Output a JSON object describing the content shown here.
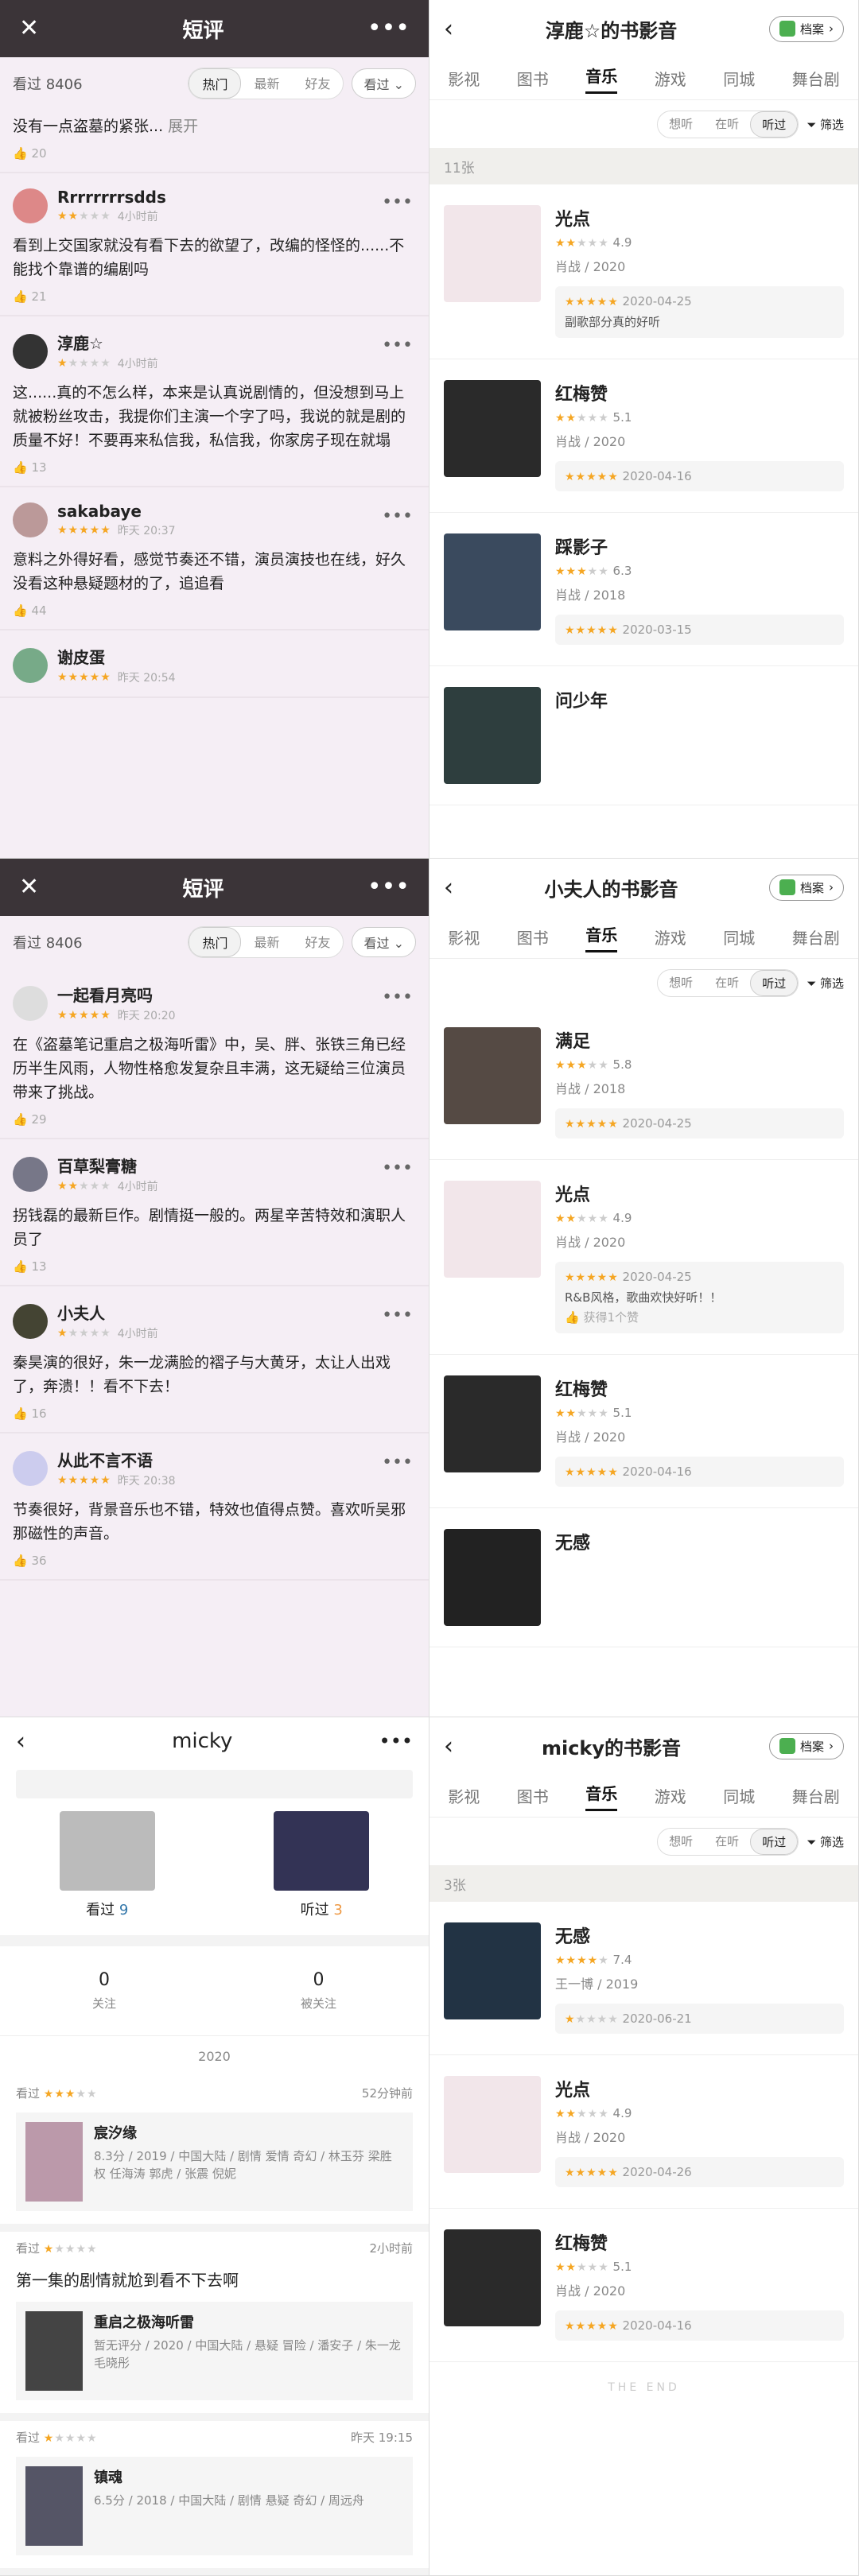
{
  "review_header": {
    "title": "短评",
    "count_label": "看过",
    "count": "8406",
    "tabs": [
      "热门",
      "最新",
      "好友"
    ],
    "filter": "看过"
  },
  "review1": [
    {
      "truncated_text": "没有一点盗墓的紧张...",
      "expand": "展开",
      "likes": "20"
    },
    {
      "user": "Rrrrrrrrsdds",
      "time": "4小时前",
      "stars": 2,
      "text": "看到上交国家就没有看下去的欲望了，改编的怪怪的......不能找个靠谱的编剧吗",
      "likes": "21"
    },
    {
      "user": "淳鹿☆",
      "time": "4小时前",
      "stars": 1,
      "text": "这......真的不怎么样，本来是认真说剧情的，但没想到马上就被粉丝攻击，我提你们主演一个字了吗，我说的就是剧的质量不好！不要再来私信我，私信我，你家房子现在就塌",
      "likes": "13"
    },
    {
      "user": "sakabaye",
      "time": "昨天 20:37",
      "stars": 5,
      "text": "意料之外得好看，感觉节奏还不错，演员演技也在线，好久没看这种悬疑题材的了，追追看",
      "likes": "44"
    },
    {
      "user": "谢皮蛋",
      "time": "昨天 20:54",
      "stars": 5
    }
  ],
  "review2": [
    {
      "user": "一起看月亮吗",
      "time": "昨天 20:20",
      "stars": 5,
      "text": "在《盗墓笔记重启之极海听雷》中，吴、胖、张铁三角已经历半生风雨，人物性格愈发复杂且丰满，这无疑给三位演员带来了挑战。",
      "likes": "29"
    },
    {
      "user": "百草梨膏糖",
      "time": "4小时前",
      "stars": 2,
      "text": "拐钱磊的最新巨作。剧情挺一般的。两星辛苦特效和演职人员了",
      "likes": "13"
    },
    {
      "user": "小夫人",
      "time": "4小时前",
      "stars": 1,
      "text": "秦昊演的很好，朱一龙满脸的褶子与大黄牙，太让人出戏了，奔溃！！看不下去！",
      "likes": "16"
    },
    {
      "user": "从此不言不语",
      "time": "昨天 20:38",
      "stars": 5,
      "text": "节奏很好，背景音乐也不错，特效也值得点赞。喜欢听吴邪那磁性的声音。",
      "likes": "36"
    }
  ],
  "archive_label": "档案",
  "cat_tabs": [
    "影视",
    "图书",
    "音乐",
    "游戏",
    "同城",
    "舞台剧"
  ],
  "sub_tabs": [
    "想听",
    "在听",
    "听过"
  ],
  "filter_label": "筛选",
  "bs1": {
    "title": "淳鹿☆的书影音",
    "count": "11张",
    "items": [
      {
        "name": "光点",
        "score": "4.9",
        "stars": 2.5,
        "artist": "肖战 / 2020",
        "date": "2020-04-25",
        "user_stars": 5,
        "note": "副歌部分真的好听"
      },
      {
        "name": "红梅赞",
        "score": "5.1",
        "stars": 2.5,
        "artist": "肖战 / 2020",
        "date": "2020-04-16",
        "user_stars": 5
      },
      {
        "name": "踩影子",
        "score": "6.3",
        "stars": 3,
        "artist": "肖战 / 2018",
        "date": "2020-03-15",
        "user_stars": 5
      },
      {
        "name": "问少年"
      }
    ]
  },
  "bs2": {
    "title": "小夫人的书影音",
    "items": [
      {
        "name": "满足",
        "score": "5.8",
        "stars": 3,
        "artist": "肖战 / 2018",
        "date": "2020-04-25",
        "user_stars": 5
      },
      {
        "name": "光点",
        "score": "4.9",
        "stars": 2.5,
        "artist": "肖战 / 2020",
        "date": "2020-04-25",
        "user_stars": 5,
        "note": "R&B风格，歌曲欢快好听！！",
        "useful": "获得1个赞"
      },
      {
        "name": "红梅赞",
        "score": "5.1",
        "stars": 2.5,
        "artist": "肖战 / 2020",
        "date": "2020-04-16",
        "user_stars": 5
      },
      {
        "name": "无感"
      }
    ]
  },
  "profile": {
    "name": "micky",
    "watched_label": "看过",
    "watched": "9",
    "listened_label": "听过",
    "listened": "3",
    "following": "0",
    "following_label": "关注",
    "followers": "0",
    "followers_label": "被关注",
    "year": "2020",
    "feed": [
      {
        "action": "看过",
        "stars": 3,
        "time": "52分钟前",
        "title": "宸汐缘",
        "desc": "8.3分 / 2019 / 中国大陆 / 剧情 爱情 奇幻 / 林玉芬 梁胜权 任海涛 郭虎 / 张震 倪妮"
      },
      {
        "action": "看过",
        "stars": 1,
        "time": "2小时前",
        "text": "第一集的剧情就尬到看不下去啊",
        "title": "重启之极海听雷",
        "desc": "暂无评分 / 2020 / 中国大陆 / 悬疑 冒险 / 潘安子 / 朱一龙 毛晓彤"
      },
      {
        "action": "看过",
        "stars": 1,
        "time": "昨天 19:15",
        "title": "镇魂",
        "desc": "6.5分 / 2018 / 中国大陆 / 剧情 悬疑 奇幻 / 周远舟"
      }
    ]
  },
  "bs3": {
    "title": "micky的书影音",
    "count": "3张",
    "items": [
      {
        "name": "无感",
        "score": "7.4",
        "stars": 3.5,
        "artist": "王一博 / 2019",
        "date": "2020-06-21",
        "user_stars": 1
      },
      {
        "name": "光点",
        "score": "4.9",
        "stars": 2.5,
        "artist": "肖战 / 2020",
        "date": "2020-04-26",
        "user_stars": 5
      },
      {
        "name": "红梅赞",
        "score": "5.1",
        "stars": 2.5,
        "artist": "肖战 / 2020",
        "date": "2020-04-16",
        "user_stars": 5
      }
    ],
    "end": "THE END"
  }
}
